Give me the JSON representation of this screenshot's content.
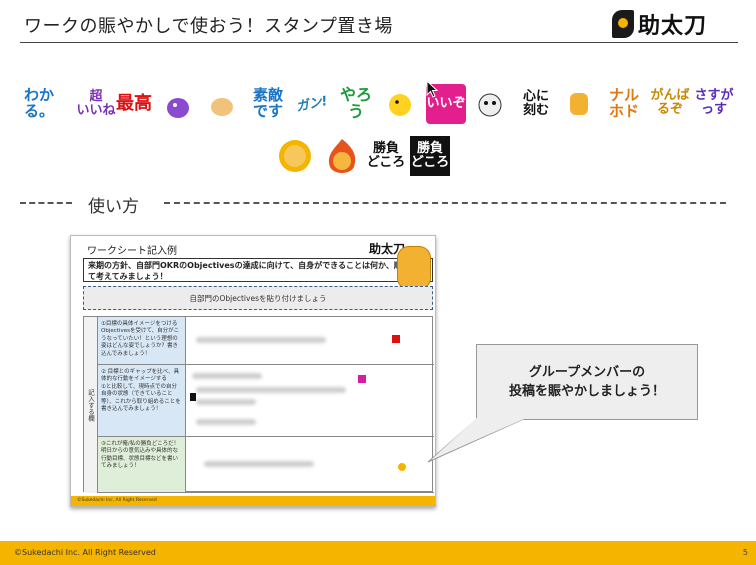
{
  "header": {
    "title": "ワークの賑やかしで使おう！スタンプ置き場",
    "logo_text": "助太刀"
  },
  "stamps": [
    {
      "label": "わか\nる。",
      "icon": "wakaru-stamp"
    },
    {
      "label": "超\nいいね",
      "icon": "chou-iine-stamp"
    },
    {
      "label": "最高",
      "icon": "saikou-stamp"
    },
    {
      "label": "",
      "icon": "purple-character-stamp"
    },
    {
      "label": "",
      "icon": "clapping-hands-stamp"
    },
    {
      "label": "素敵\nです",
      "icon": "suteki-desu-stamp"
    },
    {
      "label": "ガン!",
      "icon": "gan-stamp"
    },
    {
      "label": "やろう",
      "icon": "yarou-stamp"
    },
    {
      "label": "",
      "icon": "yellow-bird-stamp"
    },
    {
      "label": "いいぞ",
      "icon": "iizo-stamp"
    },
    {
      "label": "",
      "icon": "cat-face-stamp"
    },
    {
      "label": "心に\n刻む",
      "icon": "kokoro-ni-kizamu-stamp"
    },
    {
      "label": "",
      "icon": "tiger-small-stamp"
    },
    {
      "label": "ナル\nホド",
      "icon": "naruhodo-stamp"
    },
    {
      "label": "がんばるぞ",
      "icon": "ganbaruzo-stamp"
    },
    {
      "label": "さすがっす",
      "icon": "sasugassu-stamp"
    },
    {
      "label": "",
      "icon": "tiger-coin-stamp"
    },
    {
      "label": "",
      "icon": "fire-tiger-stamp"
    },
    {
      "label": "勝負\nどころ",
      "icon": "shoubu-dokoro-stamp"
    },
    {
      "label": "勝負\nどころ",
      "icon": "shoubu-dokoro-dark-stamp"
    }
  ],
  "section": {
    "label": "使い方"
  },
  "worksheet": {
    "title": "ワークシート記入例",
    "prompt": "来期の方針、自部門OKRのObjectivesの達成に向けて、自身ができることは何か、順序立てて考えてみましょう！",
    "paste_box": "自部門のObjectivesを貼り付けましょう",
    "side_label": "記入する欄",
    "rows": [
      {
        "left": "①目標の具体イメージをつける\nObjectivesを受けて、自分がこうなっていたい！という理想の姿はどんな姿でしょうか？書き込んでみましょう！"
      },
      {
        "left": "② 目標とのギャップを比べ、具体的な行動をイメージする\n①と比較して、現時点での自分自身の状態（できていること等）、これから取り組めることを書き込んでみましょう！"
      },
      {
        "left": "③これが俺/私の勝負どころだ！\n明日からの意気込みや具体的な行動目標、状態目標などを書いてみましょう！"
      }
    ],
    "footer": "©Sukedachi Inc. All Right Reserved"
  },
  "callout": {
    "line1": "グループメンバーの",
    "line2": "投稿を賑やかしましょう！"
  },
  "footer": {
    "copyright": "©Sukedachi Inc. All Right Reserved",
    "page": "5"
  }
}
